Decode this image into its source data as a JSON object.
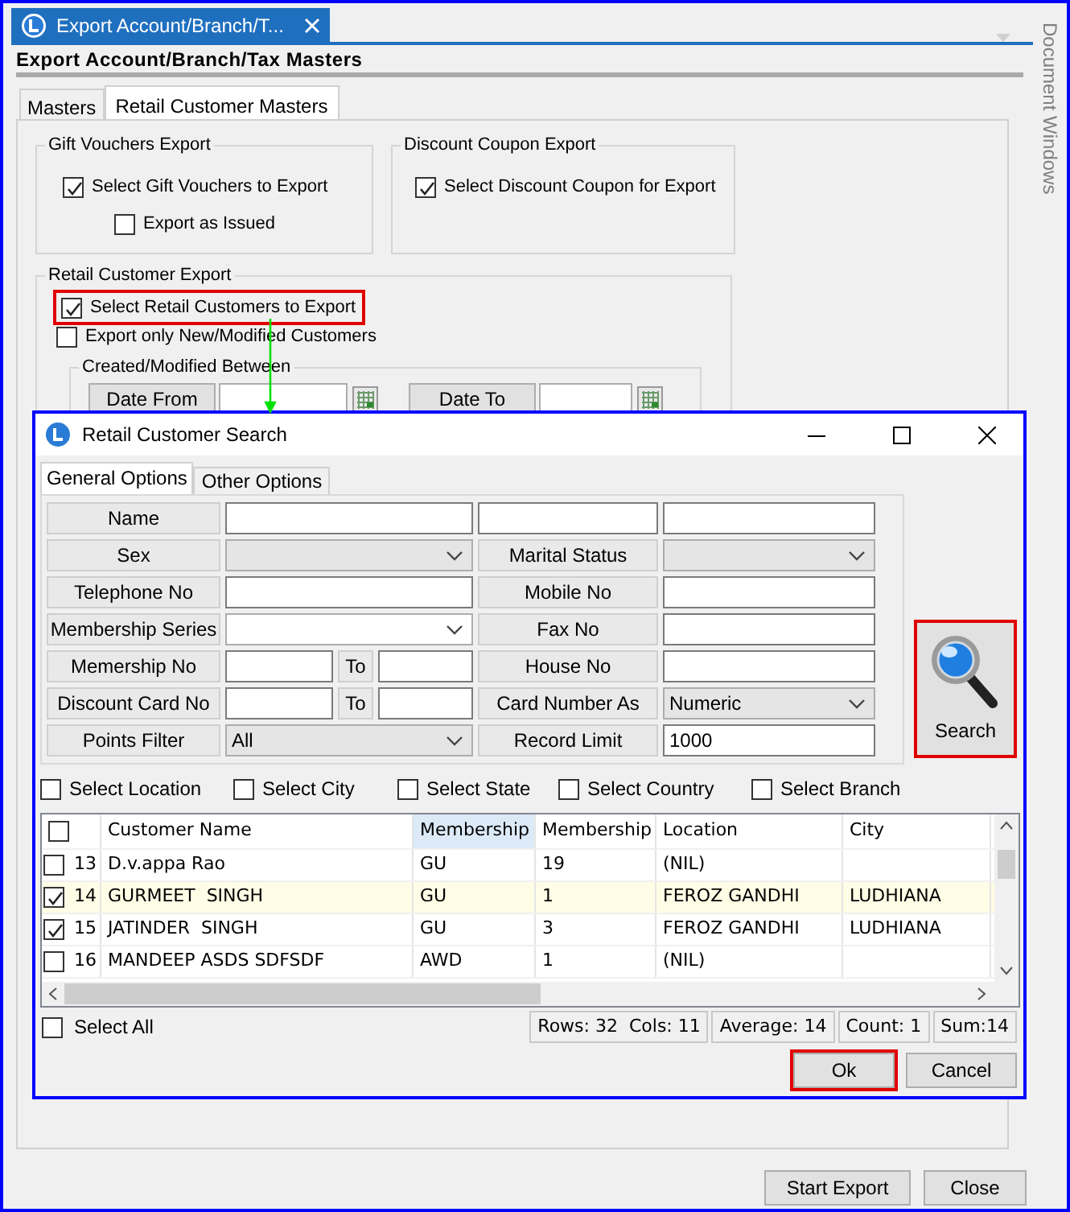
{
  "document_tab": {
    "title": "Export Account/Branch/T..."
  },
  "header": "Export Account/Branch/Tax Masters",
  "side_panel": {
    "title": "Document Windows"
  },
  "tabs": [
    {
      "label": "Masters",
      "selected": false
    },
    {
      "label": "Retail Customer Masters",
      "selected": true
    }
  ],
  "export_groups": [
    {
      "title": "Gift Vouchers Export",
      "options": [
        {
          "label": "Select Gift Vouchers to Export",
          "checked": true,
          "children": [
            {
              "label": "Export as Issued",
              "checked": false
            }
          ]
        }
      ]
    },
    {
      "title": "Discount Coupon Export",
      "options": [
        {
          "label": "Select Discount Coupon for Export",
          "checked": true
        }
      ]
    }
  ],
  "retail_group": {
    "title": "Retail Customer Export",
    "options": [
      {
        "label": "Select Retail Customers to Export",
        "checked": true,
        "highlighted": true
      },
      {
        "label": "Export only New/Modified Customers",
        "checked": false,
        "highlighted": false
      }
    ],
    "date_range": {
      "title": "Created/Modified Between",
      "fields": [
        {
          "label": "Date From"
        },
        {
          "label": "Date To"
        }
      ]
    }
  },
  "dialog": {
    "title": "Retail Customer Search",
    "tabs": [
      {
        "label": "General Options",
        "selected": true
      },
      {
        "label": "Other Options",
        "selected": false
      }
    ],
    "form": [
      {
        "cells": [
          {
            "kind": "label",
            "text": "Name"
          },
          {
            "kind": "input"
          },
          {
            "kind": "input"
          },
          {
            "kind": "input"
          }
        ]
      },
      {
        "cells": [
          {
            "kind": "label",
            "text": "Sex"
          },
          {
            "kind": "select",
            "disabled": true
          },
          {
            "kind": "label",
            "text": "Marital Status"
          },
          {
            "kind": "select",
            "disabled": true
          }
        ]
      },
      {
        "cells": [
          {
            "kind": "label",
            "text": "Telephone No"
          },
          {
            "kind": "input"
          },
          {
            "kind": "label",
            "text": "Mobile No"
          },
          {
            "kind": "input"
          }
        ]
      },
      {
        "cells": [
          {
            "kind": "label",
            "text": "Membership Series"
          },
          {
            "kind": "select",
            "disabled": false
          },
          {
            "kind": "label",
            "text": "Fax No"
          },
          {
            "kind": "input"
          }
        ]
      },
      {
        "cells": [
          {
            "kind": "label",
            "text": "Memership No"
          },
          {
            "kind": "range",
            "to": "To"
          },
          {
            "kind": "label",
            "text": "House No"
          },
          {
            "kind": "input"
          }
        ]
      },
      {
        "cells": [
          {
            "kind": "label",
            "text": "Discount Card No"
          },
          {
            "kind": "range",
            "to": "To"
          },
          {
            "kind": "label",
            "text": "Card Number As"
          },
          {
            "kind": "select",
            "disabled": true,
            "value": "Numeric"
          }
        ]
      },
      {
        "cells": [
          {
            "kind": "label",
            "text": "Points Filter"
          },
          {
            "kind": "select",
            "disabled": true,
            "value": "All"
          },
          {
            "kind": "label",
            "text": "Record Limit"
          },
          {
            "kind": "input",
            "value": "1000"
          }
        ]
      }
    ],
    "search_button": {
      "label": "Search",
      "highlighted": true
    },
    "filters": [
      {
        "label": "Select Location",
        "checked": false
      },
      {
        "label": "Select City",
        "checked": false
      },
      {
        "label": "Select State",
        "checked": false
      },
      {
        "label": "Select Country",
        "checked": false
      },
      {
        "label": "Select Branch",
        "checked": false
      }
    ],
    "grid": {
      "header_checked": false,
      "columns": [
        {
          "label": "Customer Name",
          "highlighted": false
        },
        {
          "label": "Membership",
          "highlighted": true
        },
        {
          "label": "Membership",
          "highlighted": false
        },
        {
          "label": "Location",
          "highlighted": false
        },
        {
          "label": "City",
          "highlighted": false
        }
      ],
      "rows": [
        {
          "number": "13",
          "checked": false,
          "selected": false,
          "cells": [
            "D.v.appa Rao",
            "GU",
            "19",
            "(NIL)"
          ]
        },
        {
          "number": "14",
          "checked": true,
          "selected": true,
          "cells": [
            "GURMEET  SINGH",
            "GU",
            "1",
            "FEROZ GANDHI",
            "LUDHIANA"
          ]
        },
        {
          "number": "15",
          "checked": true,
          "selected": false,
          "cells": [
            "JATINDER  SINGH",
            "GU",
            "3",
            "FEROZ GANDHI",
            "LUDHIANA"
          ]
        },
        {
          "number": "16",
          "checked": false,
          "selected": false,
          "cells": [
            "MANDEEP ASDS SDFSDF",
            "AWD",
            "1",
            "(NIL)"
          ]
        }
      ]
    },
    "select_all": {
      "label": "Select All",
      "checked": false
    },
    "status": [
      "Rows: 32  Cols: 11",
      "Average: 14",
      "Count: 1",
      "Sum:14"
    ],
    "buttons": [
      {
        "label": "Ok",
        "highlighted": true
      },
      {
        "label": "Cancel",
        "highlighted": false
      }
    ]
  },
  "buttons": [
    {
      "label": "Start Export"
    },
    {
      "label": "Close"
    }
  ]
}
